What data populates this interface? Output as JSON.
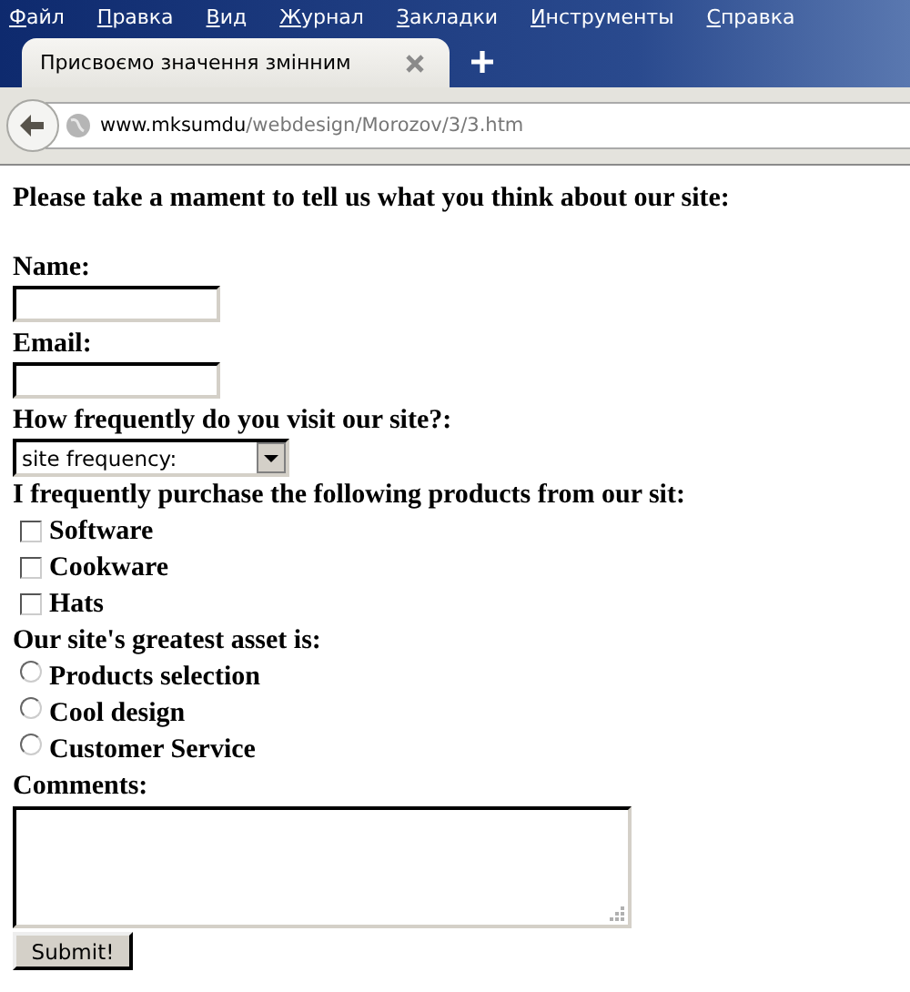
{
  "menu": [
    "Файл",
    "Правка",
    "Вид",
    "Журнал",
    "Закладки",
    "Инструменты",
    "Справка"
  ],
  "tab": {
    "title": "Присвоємо значення змінним",
    "selected": true
  },
  "address": {
    "host": "www.mksumdu",
    "path": "/webdesign/Morozov/3/3.htm"
  },
  "form": {
    "intro": "Please take a mament to tell us what you think about our site:",
    "name_label": "Name:",
    "email_label": "Email:",
    "frequency_label": "How frequently do you visit our site?:",
    "frequency_value": "site frequency:",
    "products_label": "I frequently purchase the following products from our sit:",
    "products": [
      {
        "label": "Software",
        "checked": false
      },
      {
        "label": "Cookware",
        "checked": false
      },
      {
        "label": "Hats",
        "checked": false
      }
    ],
    "asset_label": "Our site's greatest asset is:",
    "assets": [
      {
        "label": "Products selection",
        "selected": false
      },
      {
        "label": "Cool design",
        "selected": false
      },
      {
        "label": "Customer Service",
        "selected": false
      }
    ],
    "comments_label": "Comments:",
    "submit": "Submit!"
  }
}
